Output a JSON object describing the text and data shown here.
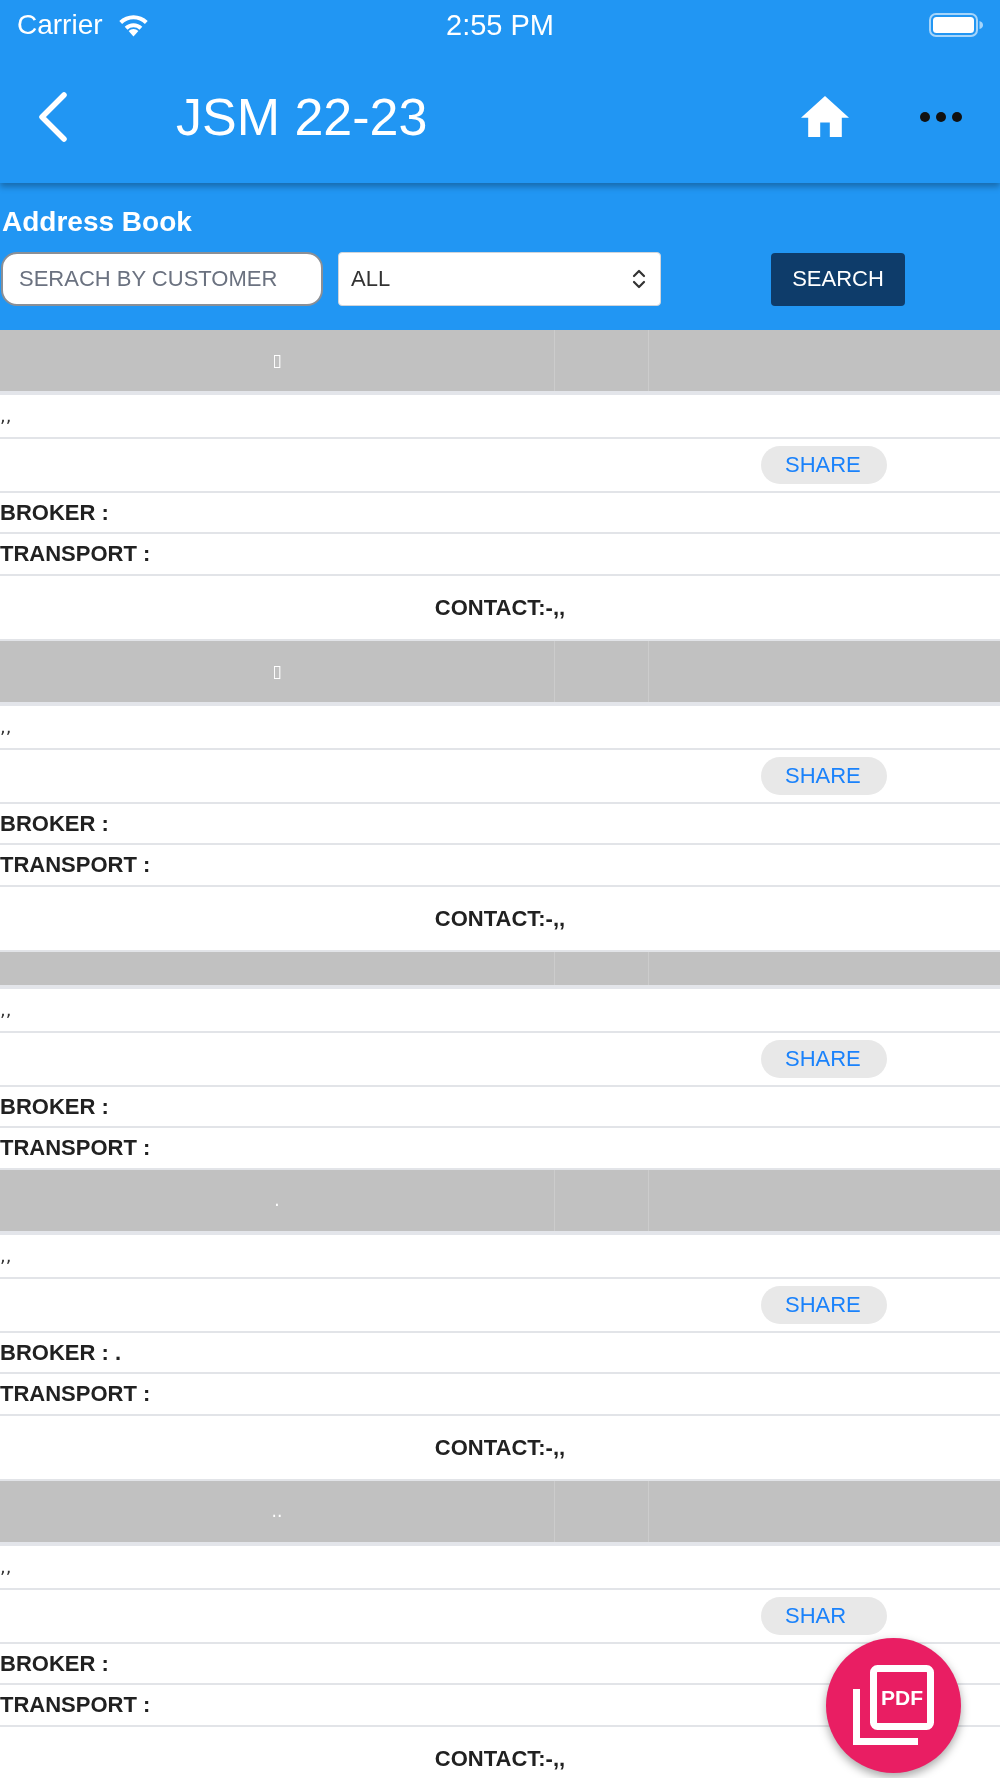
{
  "status_bar": {
    "carrier": "Carrier",
    "time": "2:55 PM"
  },
  "nav_bar": {
    "title": "JSM 22-23"
  },
  "address_book": {
    "title": "Address Book",
    "search": {
      "placeholder": "SERACH BY CUSTOMER"
    },
    "filter": {
      "value": "ALL"
    },
    "search_button": "SEARCH"
  },
  "cards": [
    {
      "header": "▯",
      "address": ",,",
      "share": "SHARE",
      "broker": "BROKER :",
      "transport": "TRANSPORT :",
      "contact": "CONTACT:-,,"
    },
    {
      "header": "▯",
      "address": ",,",
      "share": "SHARE",
      "broker": "BROKER :",
      "transport": "TRANSPORT :",
      "contact": "CONTACT:-,,"
    },
    {
      "address": ",,",
      "share": "SHARE",
      "broker": "BROKER :",
      "transport": "TRANSPORT :"
    },
    {
      "header": ".",
      "address": ",,",
      "share": "SHARE",
      "broker": "BROKER : .",
      "transport": "TRANSPORT :",
      "contact": "CONTACT:-,,"
    },
    {
      "header": "..",
      "address": ",,",
      "share": "SHAR",
      "broker": "BROKER :",
      "transport": "TRANSPORT :",
      "contact": "CONTACT:-,,"
    }
  ],
  "fab": {
    "label": "PDF"
  }
}
